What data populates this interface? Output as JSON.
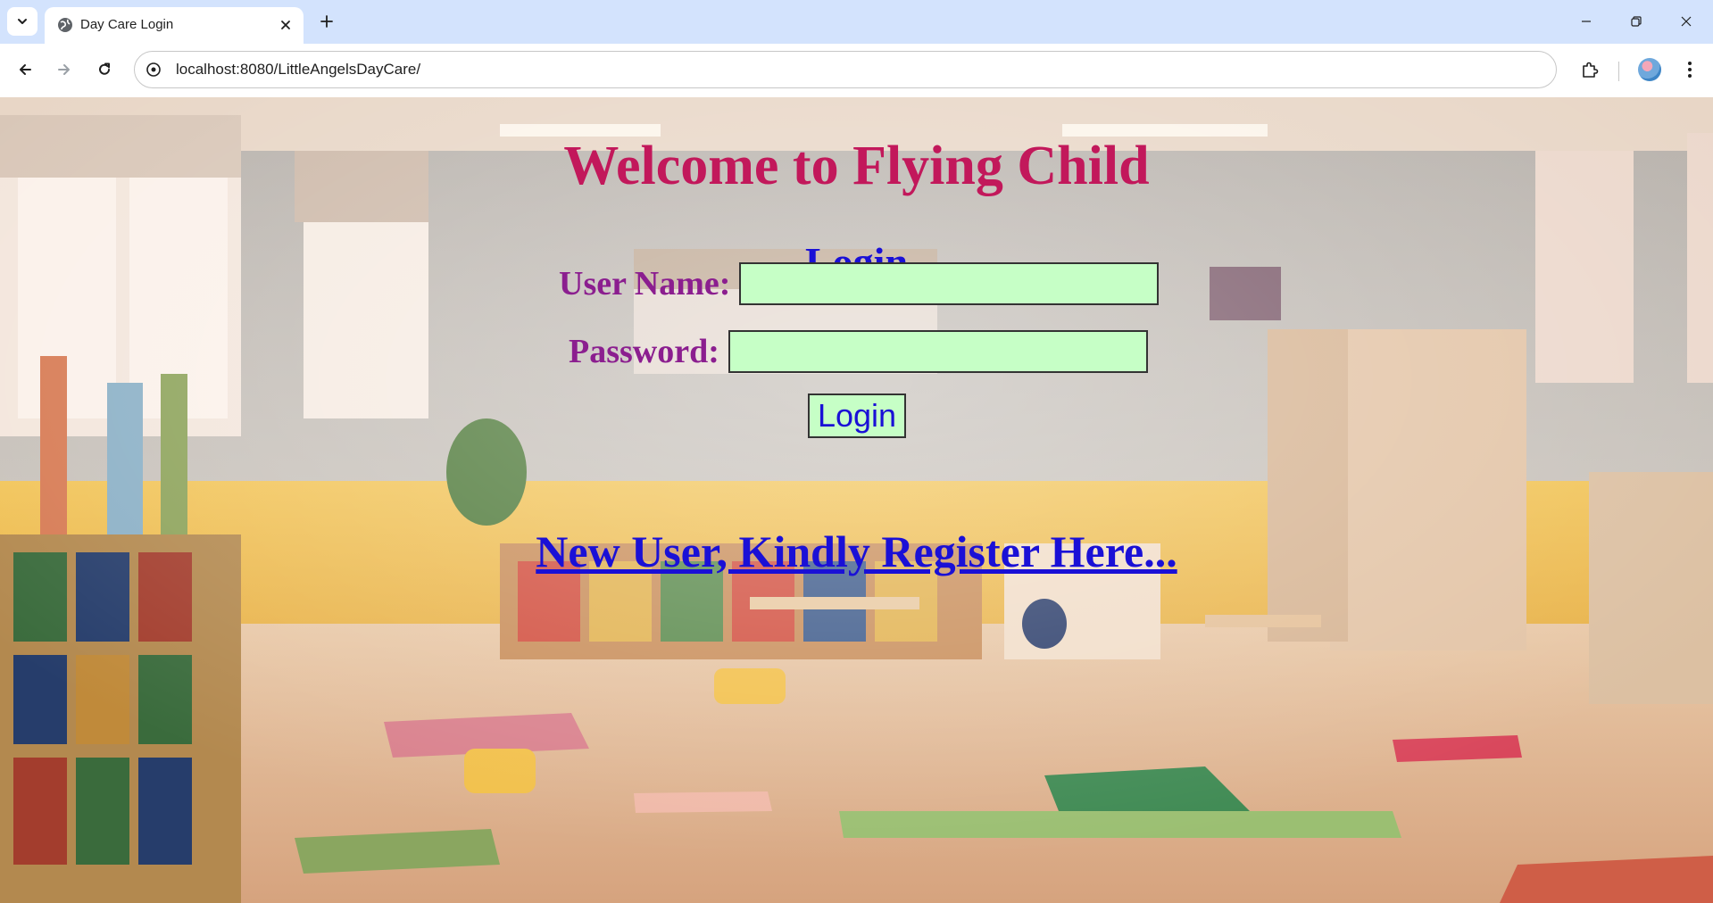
{
  "browser": {
    "tab": {
      "title": "Day Care Login"
    },
    "address_bar": {
      "url": "localhost:8080/LittleAngelsDayCare/"
    }
  },
  "page": {
    "welcome_title": "Welcome to Flying Child",
    "login_heading": "----Login----",
    "form": {
      "username_label": "User Name:",
      "username_value": "",
      "password_label": "Password:",
      "password_value": "",
      "login_button_label": "Login"
    },
    "register_link": "New User, Kindly Register Here..."
  },
  "colors": {
    "title": "#c2185b",
    "heading": "#1a10d6",
    "label": "#8b1e8f",
    "input_bg": "#c6ffc6",
    "link": "#1a10d6",
    "chrome_tabstrip": "#d3e3fd"
  }
}
